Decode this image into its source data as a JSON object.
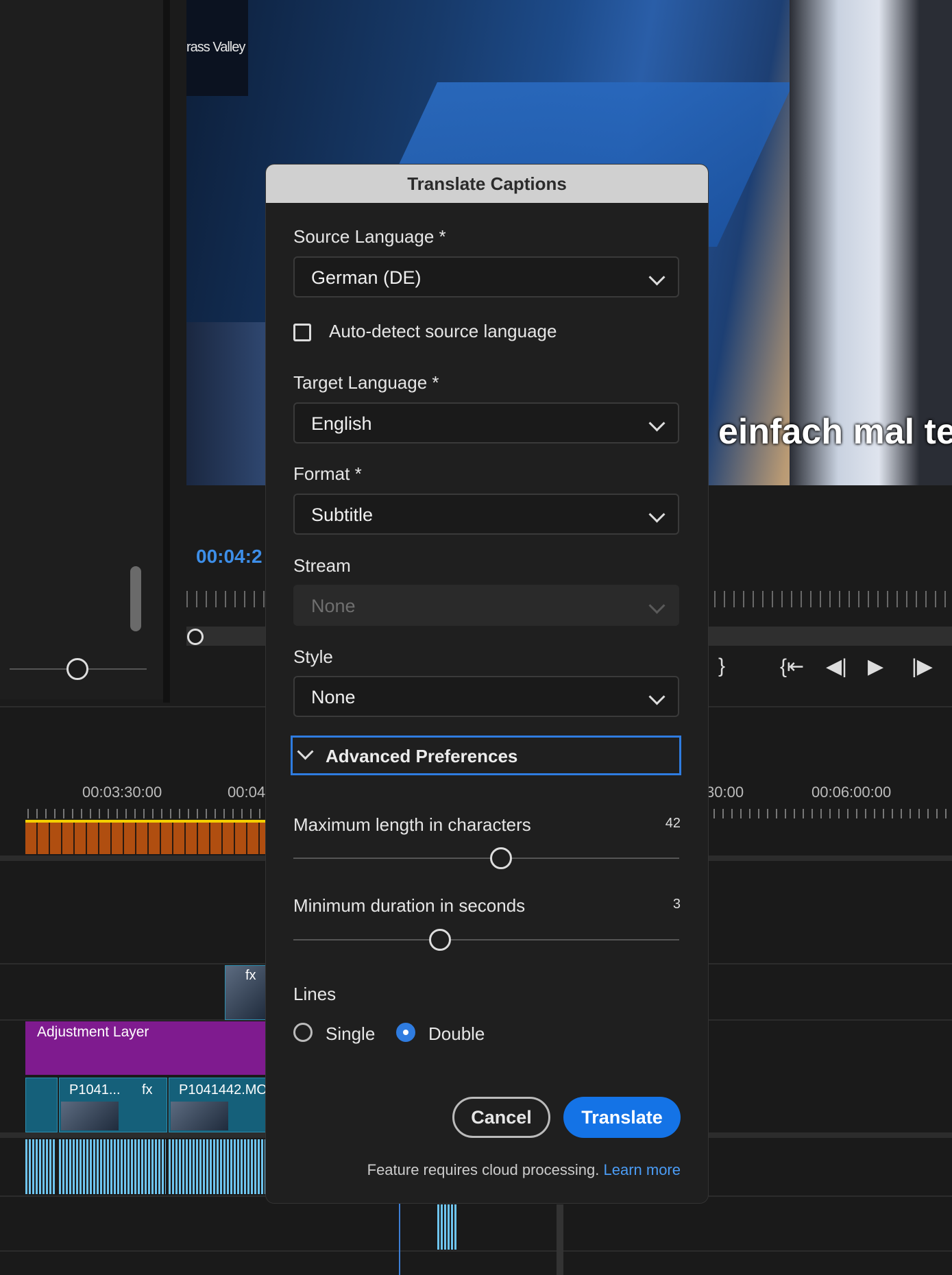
{
  "video": {
    "brand_text": "rass Valley",
    "caption_text": "einfach mal te"
  },
  "monitor": {
    "timecode": "00:04:2"
  },
  "timeline": {
    "time_labels": [
      "00:03:30:00",
      "00:04",
      "30:00",
      "00:06:00:00"
    ],
    "adjustment_layer_label": "Adjustment Layer",
    "clips": [
      "P1041...",
      "P1041442.MO"
    ],
    "fx_label": "fx"
  },
  "dialog": {
    "title": "Translate Captions",
    "source_language": {
      "label": "Source Language *",
      "value": "German (DE)"
    },
    "auto_detect": {
      "label": "Auto-detect source language",
      "checked": false
    },
    "target_language": {
      "label": "Target Language *",
      "value": "English"
    },
    "format": {
      "label": "Format *",
      "value": "Subtitle"
    },
    "stream": {
      "label": "Stream",
      "value": "None",
      "disabled": true
    },
    "style": {
      "label": "Style",
      "value": "None"
    },
    "advanced": {
      "label": "Advanced Preferences",
      "expanded": true
    },
    "max_length": {
      "label": "Maximum length in characters",
      "value": "42"
    },
    "min_duration": {
      "label": "Minimum duration in seconds",
      "value": "3"
    },
    "lines": {
      "label": "Lines",
      "options": [
        "Single",
        "Double"
      ],
      "selected": "Double"
    },
    "buttons": {
      "cancel": "Cancel",
      "translate": "Translate"
    },
    "footnote": {
      "text": "Feature requires cloud processing.",
      "link": "Learn more"
    },
    "accent_color": "#1473e6"
  }
}
